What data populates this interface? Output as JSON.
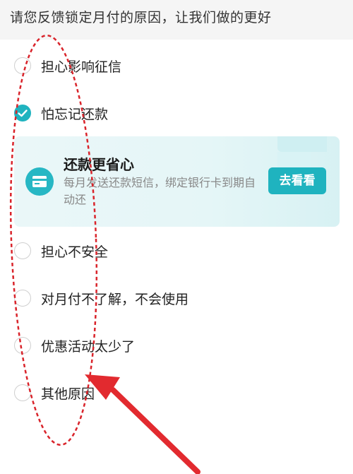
{
  "header": {
    "text": "请您反馈锁定月付的原因，让我们做的更好"
  },
  "options": [
    {
      "label": "担心影响征信",
      "checked": false
    },
    {
      "label": "怕忘记还款",
      "checked": true
    },
    {
      "label": "担心不安全",
      "checked": false
    },
    {
      "label": "对月付不了解，不会使用",
      "checked": false
    },
    {
      "label": "优惠活动太少了",
      "checked": false
    },
    {
      "label": "其他原因",
      "checked": false
    }
  ],
  "promo": {
    "title": "还款更省心",
    "description": "每月发送还款短信，绑定银行卡到期自动还",
    "button_label": "去看看",
    "icon": "card-icon"
  },
  "colors": {
    "accent": "#1fb3bf",
    "annotation": "#d9242b",
    "header_bg": "#f5f5f5"
  }
}
